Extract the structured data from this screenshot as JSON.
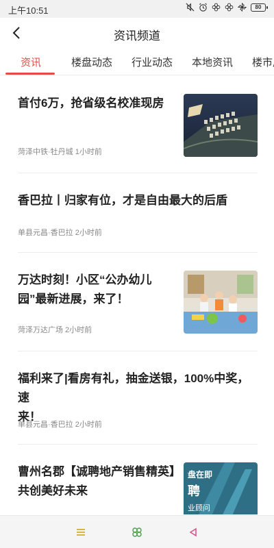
{
  "status_bar": {
    "time": "上午10:51",
    "icons": [
      "mute-icon",
      "alarm-icon",
      "flower-icon",
      "flower-icon",
      "pinwheel-icon"
    ],
    "battery": "80"
  },
  "header": {
    "title": "资讯频道",
    "back_icon": "chevron-left-icon"
  },
  "tabs": [
    {
      "label": "资讯",
      "active": true
    },
    {
      "label": "楼盘动态",
      "active": false
    },
    {
      "label": "行业动态",
      "active": false
    },
    {
      "label": "本地资讯",
      "active": false
    },
    {
      "label": "楼市later",
      "active": false
    }
  ],
  "articles": [
    {
      "title_lines": [
        "首付6万，抢省级名校准现房"
      ],
      "meta": "菏泽中铁·牡丹城   1小时前",
      "has_image": true,
      "image": "aerial-city-photo"
    },
    {
      "title_lines": [
        "香巴拉丨归家有位，才是自由最大的后盾"
      ],
      "meta": "单县元昌·香巴拉   2小时前",
      "has_image": false
    },
    {
      "title_lines": [
        "万达时刻！小区“公办幼儿",
        "园”最新进展，来了！"
      ],
      "meta": "菏泽万达广场   2小时前",
      "has_image": true,
      "image": "kindergarten-photo"
    },
    {
      "title_lines": [
        "福利来了|看房有礼，抽金送银，100%中奖，速",
        "来！"
      ],
      "meta": "单县元昌·香巴拉   2小时前",
      "has_image": false
    },
    {
      "title_lines": [
        "曹州名郡【诚聘地产销售精英】",
        "共创美好未来"
      ],
      "meta": "",
      "has_image": true,
      "image": "recruitment-poster",
      "image_text": [
        "盘在即",
        "聘",
        "业顾问"
      ]
    }
  ],
  "system_nav": {
    "menu_icon": "menu-icon",
    "home_icon": "home-icon",
    "back_icon": "back-triangle-icon"
  },
  "colors": {
    "accent": "#e64a4a",
    "text": "#222222",
    "meta": "#888888"
  }
}
